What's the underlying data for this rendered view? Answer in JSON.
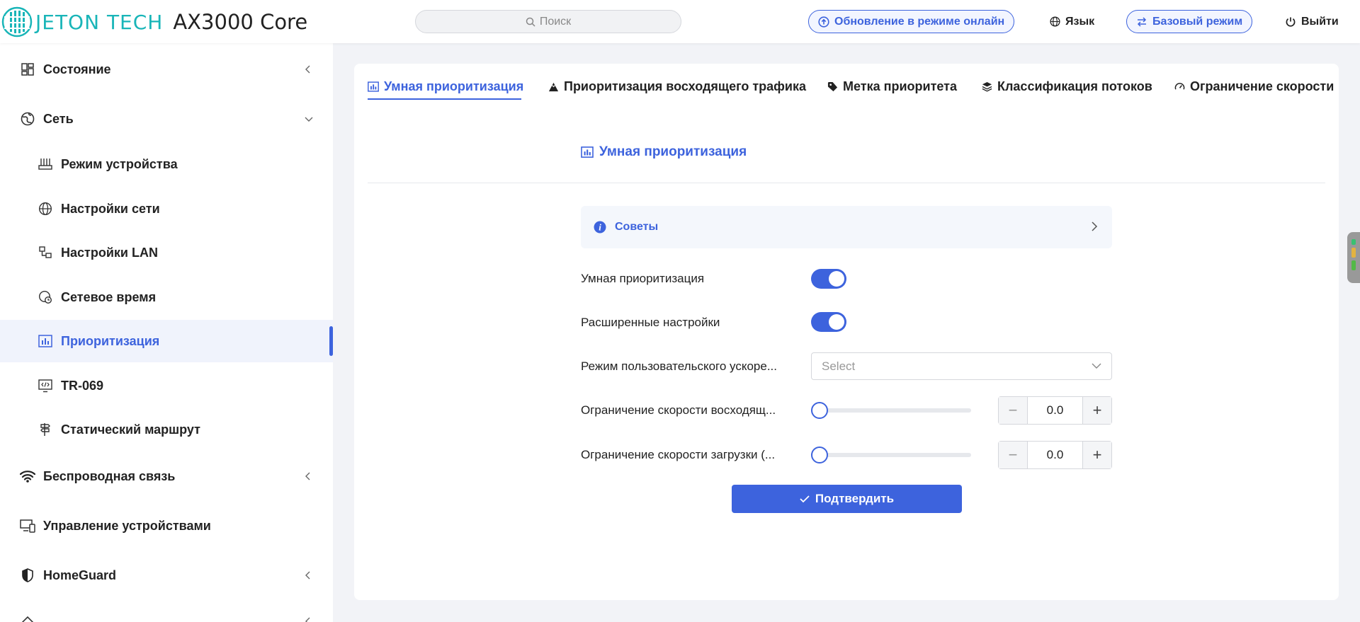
{
  "header": {
    "brand": "JETON TECH",
    "model": "AX3000 Core",
    "search_placeholder": "Поиск",
    "online_update": "Обновление в режиме онлайн",
    "language": "Язык",
    "basic_mode": "Базовый режим",
    "logout": "Выйти"
  },
  "sidebar": {
    "status": "Состояние",
    "network": "Сеть",
    "network_items": [
      "Режим устройства",
      "Настройки сети",
      "Настройки LAN",
      "Сетевое время",
      "Приоритизация",
      "TR-069",
      "Статический маршрут"
    ],
    "wireless": "Беспроводная связь",
    "device_management": "Управление устройствами",
    "homeguard": "HomeGuard"
  },
  "tabs": [
    "Умная приоритизация",
    "Приоритизация восходящего трафика",
    "Метка приоритета",
    "Классификация потоков",
    "Ограничение скорости"
  ],
  "content": {
    "section_title": "Умная приоритизация",
    "tips_label": "Советы",
    "smart_qos_label": "Умная приоритизация",
    "smart_qos_enabled": true,
    "advanced_label": "Расширенные настройки",
    "advanced_enabled": true,
    "custom_mode_label": "Режим пользовательского ускоре...",
    "custom_mode_placeholder": "Select",
    "upload_limit_label": "Ограничение скорости восходящ...",
    "upload_limit_value": "0.0",
    "download_limit_label": "Ограничение скорости загрузки (...",
    "download_limit_value": "0.0",
    "confirm_label": "Подтвердить"
  },
  "colors": {
    "accent": "#3d63dd",
    "brand": "#19b5b8"
  }
}
